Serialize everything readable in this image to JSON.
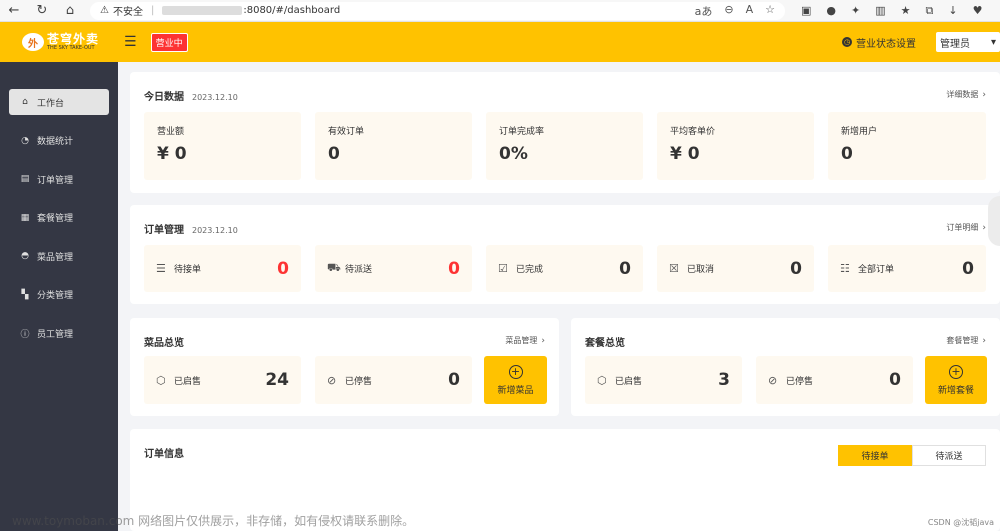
{
  "browser": {
    "insecure_label": "不安全",
    "url_suffix": ":8080/#/dashboard",
    "read_aloud": "aあ"
  },
  "header": {
    "logo_cn": "苍穹外卖",
    "logo_en": "THE SKY TAKE-OUT",
    "status": "营业中",
    "settings": "营业状态设置",
    "user": "管理员"
  },
  "sidebar": {
    "items": [
      {
        "label": "工作台",
        "icon": "home-icon"
      },
      {
        "label": "数据统计",
        "icon": "chart-icon"
      },
      {
        "label": "订单管理",
        "icon": "clipboard-icon"
      },
      {
        "label": "套餐管理",
        "icon": "gift-icon"
      },
      {
        "label": "菜品管理",
        "icon": "dish-icon"
      },
      {
        "label": "分类管理",
        "icon": "grid-icon"
      },
      {
        "label": "员工管理",
        "icon": "info-icon"
      }
    ]
  },
  "today": {
    "title": "今日数据",
    "date": "2023.12.10",
    "link": "详细数据",
    "stats": [
      {
        "label": "营业额",
        "value": "¥ 0"
      },
      {
        "label": "有效订单",
        "value": "0"
      },
      {
        "label": "订单完成率",
        "value": "0%"
      },
      {
        "label": "平均客单价",
        "value": "¥ 0"
      },
      {
        "label": "新增用户",
        "value": "0"
      }
    ]
  },
  "orders": {
    "title": "订单管理",
    "date": "2023.12.10",
    "link": "订单明细",
    "items": [
      {
        "label": "待接单",
        "value": "0",
        "icon": "pending-icon"
      },
      {
        "label": "待派送",
        "value": "0",
        "icon": "delivery-icon"
      },
      {
        "label": "已完成",
        "value": "0",
        "icon": "done-icon"
      },
      {
        "label": "已取消",
        "value": "0",
        "icon": "cancel-icon"
      },
      {
        "label": "全部订单",
        "value": "0",
        "icon": "list-icon"
      }
    ]
  },
  "dishes": {
    "title": "菜品总览",
    "link": "菜品管理",
    "on_label": "已启售",
    "on_value": "24",
    "off_label": "已停售",
    "off_value": "0",
    "add_label": "新增菜品"
  },
  "setmeals": {
    "title": "套餐总览",
    "link": "套餐管理",
    "on_label": "已启售",
    "on_value": "3",
    "off_label": "已停售",
    "off_value": "0",
    "add_label": "新增套餐"
  },
  "order_info": {
    "title": "订单信息",
    "tabs": [
      "待接单",
      "待派送"
    ]
  },
  "watermark": "www.toymoban.com 网络图片仅供展示，非存储，如有侵权请联系删除。",
  "csdn": "CSDN @沈韬java",
  "colors": {
    "accent": "#ffc200",
    "sidebar": "#343744",
    "red": "#fd3333"
  }
}
